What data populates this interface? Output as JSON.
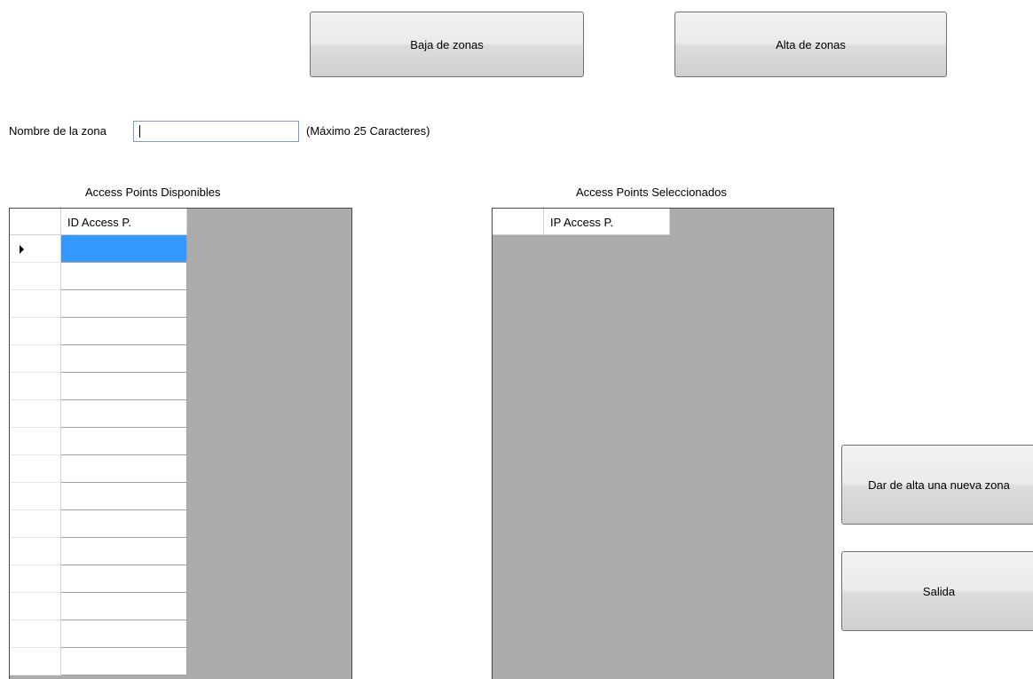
{
  "toolbar": {
    "baja_label": "Baja de zonas",
    "alta_label": "Alta de zonas"
  },
  "form": {
    "zone_name_label": "Nombre de la zona",
    "zone_name_value": "",
    "max_hint": "(Máximo 25 Caracteres)"
  },
  "available_grid": {
    "title": "Access Points Disponibles",
    "column_header": "ID Access P.",
    "rows": [
      "",
      "",
      "",
      "",
      "",
      "",
      "",
      "",
      "",
      "",
      "",
      "",
      "",
      "",
      "",
      ""
    ],
    "selected_row": 0
  },
  "selected_grid": {
    "title": "Access Points Seleccionados",
    "column_header": "IP Access P.",
    "rows": []
  },
  "actions": {
    "new_zone_label": "Dar de alta una nueva zona",
    "exit_label": "Salida"
  },
  "colors": {
    "grid_background": "#ababab",
    "selection": "#3399ff"
  }
}
